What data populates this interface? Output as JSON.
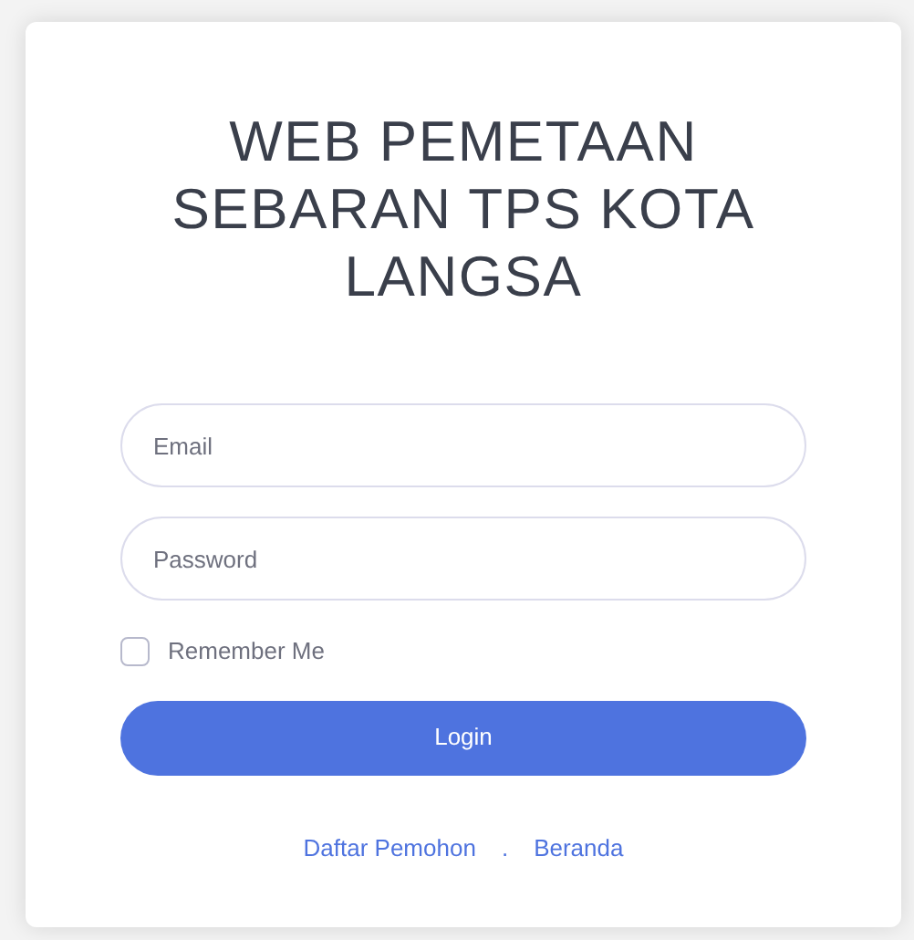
{
  "title_lines": [
    "WEB PEMETAAN",
    "SEBARAN TPS KOTA",
    "LANGSA"
  ],
  "fields": [
    {
      "placeholder": "Email"
    },
    {
      "placeholder": "Password"
    }
  ],
  "remember": {
    "label": "Remember Me",
    "checked": false
  },
  "login_button": "Login",
  "links": [
    "Daftar Pemohon",
    "Beranda"
  ],
  "link_separator": "."
}
